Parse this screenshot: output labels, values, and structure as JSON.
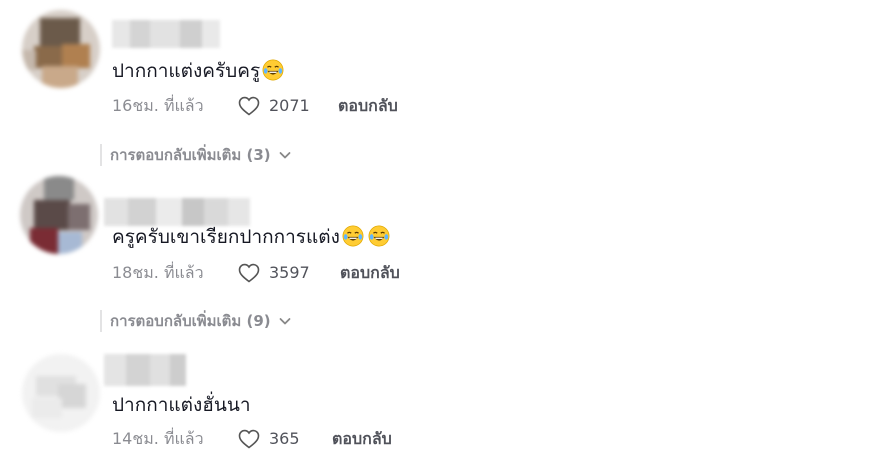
{
  "colors": {
    "text_primary": "#161823",
    "text_secondary": "rgba(22,24,35,0.5)",
    "background": "#ffffff"
  },
  "comments": [
    {
      "text": "ปากกาแต่งครับครู",
      "emojis": [
        "tears-of-joy-emoji"
      ],
      "time": "16ชม. ที่แล้ว",
      "likes": "2071",
      "reply_label": "ตอบกลับ",
      "more_replies": "การตอบกลับเพิ่มเติม (3)"
    },
    {
      "text": "ครูครับเขาเรียกปากการแต่ง",
      "emojis": [
        "tears-of-joy-emoji",
        "tears-of-joy-emoji"
      ],
      "time": "18ชม. ที่แล้ว",
      "likes": "3597",
      "reply_label": "ตอบกลับ",
      "more_replies": "การตอบกลับเพิ่มเติม (9)"
    },
    {
      "text": "ปากกาแต่งฮั่นนา",
      "emojis": [],
      "time": "14ชม. ที่แล้ว",
      "likes": "365",
      "reply_label": "ตอบกลับ"
    }
  ],
  "icons": {
    "like": "heart-outline-icon",
    "expand": "chevron-down-icon"
  }
}
